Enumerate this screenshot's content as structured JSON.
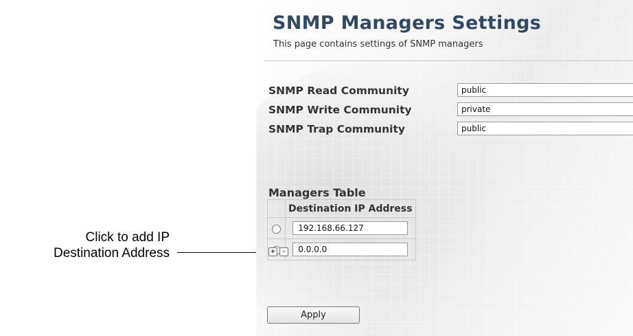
{
  "callout": {
    "line1": "Click to add  IP",
    "line2": "Destination Address"
  },
  "page": {
    "title": "SNMP Managers Settings",
    "subtitle": "This page contains settings of SNMP managers"
  },
  "communities": [
    {
      "label": "SNMP Read Community",
      "value": "public"
    },
    {
      "label": "SNMP Write Community",
      "value": "private"
    },
    {
      "label": "SNMP Trap Community",
      "value": "public"
    }
  ],
  "managers": {
    "title": "Managers Table",
    "column_header": "Destination IP Address",
    "rows": [
      {
        "ip": "192.168.66.127",
        "selected": false
      },
      {
        "ip": "0.0.0.0",
        "selected": false
      }
    ],
    "add_label": "+",
    "remove_label": "-"
  },
  "apply_label": "Apply"
}
